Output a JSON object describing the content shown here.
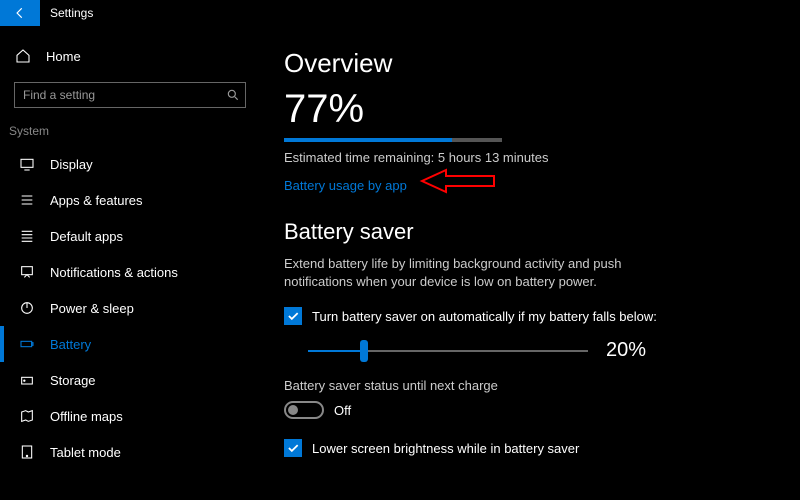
{
  "title": "Settings",
  "home_label": "Home",
  "search_placeholder": "Find a setting",
  "section_label": "System",
  "nav": [
    {
      "label": "Display"
    },
    {
      "label": "Apps & features"
    },
    {
      "label": "Default apps"
    },
    {
      "label": "Notifications & actions"
    },
    {
      "label": "Power & sleep"
    },
    {
      "label": "Battery"
    },
    {
      "label": "Storage"
    },
    {
      "label": "Offline maps"
    },
    {
      "label": "Tablet mode"
    }
  ],
  "overview": {
    "heading": "Overview",
    "percent": "77%",
    "percent_num": 77,
    "estimate": "Estimated time remaining: 5 hours 13 minutes",
    "link": "Battery usage by app"
  },
  "saver": {
    "heading": "Battery saver",
    "desc": "Extend battery life by limiting background activity and push notifications when your device is low on battery power.",
    "auto_label": "Turn battery saver on automatically if my battery falls below:",
    "slider_value": 20,
    "slider_text": "20%",
    "status_label": "Battery saver status until next charge",
    "toggle_state": "Off",
    "brightness_label": "Lower screen brightness while in battery saver"
  }
}
